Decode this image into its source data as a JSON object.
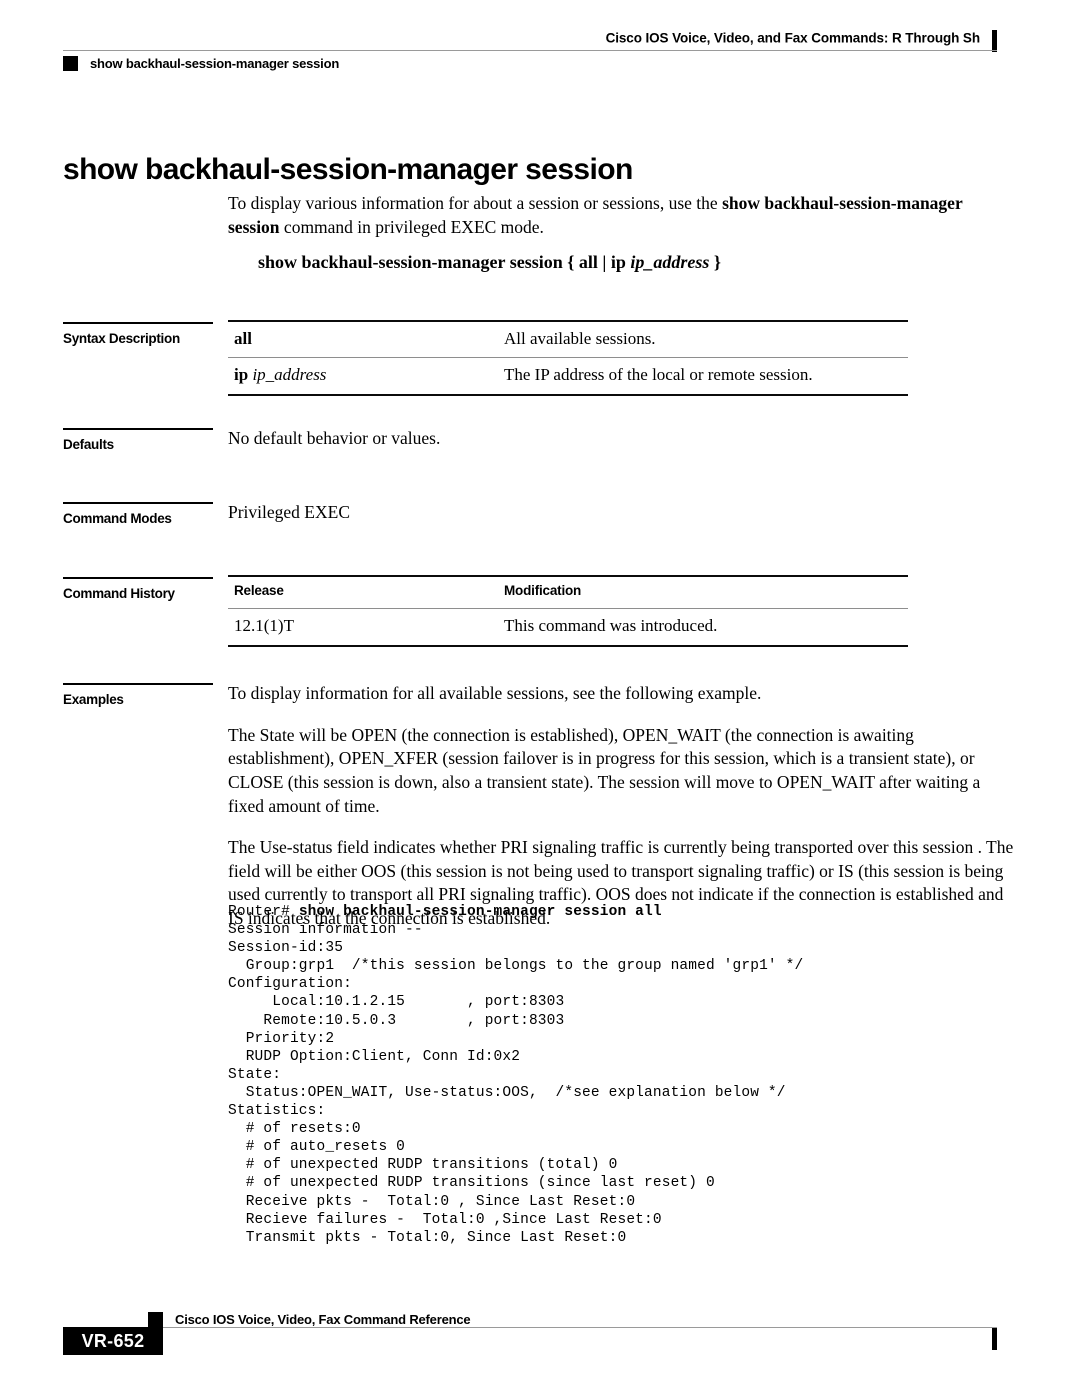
{
  "header": {
    "book_title": "Cisco IOS Voice, Video, and Fax Commands: R Through Sh",
    "running_head": "show backhaul-session-manager session"
  },
  "page": {
    "command_title": "show backhaul-session-manager session",
    "intro": {
      "text_before": "To display various information for about a session or sessions, use the ",
      "bold_command": "show backhaul-session-manager session",
      "text_after": " command in privileged EXEC mode."
    },
    "syntax": {
      "command": "show backhaul-session-manager session",
      "open_brace": "{",
      "option_all": "all",
      "pipe": "|",
      "option_ip": "ip",
      "argument": "ip_address",
      "close_brace": "}"
    }
  },
  "sections": {
    "syntax_description": {
      "label": "Syntax Description",
      "rows": [
        {
          "term": "all",
          "term_italic": "",
          "description": "All available sessions."
        },
        {
          "term": "ip",
          "term_italic": "ip_address",
          "description": "The IP address of the local or remote session."
        }
      ]
    },
    "defaults": {
      "label": "Defaults",
      "text": "No default behavior or values."
    },
    "command_modes": {
      "label": "Command Modes",
      "text": "Privileged EXEC"
    },
    "command_history": {
      "label": "Command History",
      "headers": {
        "release": "Release",
        "modification": "Modification"
      },
      "rows": [
        {
          "release": "12.1(1)T",
          "modification": "This command was introduced."
        }
      ]
    },
    "examples": {
      "label": "Examples",
      "paragraphs": [
        "To display information for all available sessions, see the following example.",
        "The State will be OPEN (the connection is established), OPEN_WAIT (the connection is awaiting establishment), OPEN_XFER (session failover is in progress for this session, which is a transient state), or CLOSE (this session is down, also a transient state). The session will move to OPEN_WAIT after waiting a fixed amount of time.",
        "The Use-status field indicates whether PRI signaling traffic is currently being transported over this session . The field will be either OOS (this session is not being used to transport signaling traffic) or IS (this session is being used currently to transport all PRI signaling traffic). OOS does not indicate if the connection is established and IS indicates that the connection is established."
      ],
      "console_output": {
        "prompt": "Router# ",
        "typed_command": "show backhaul-session-manager session all",
        "body": "\nSession information --\nSession-id:35\n  Group:grp1  /*this session belongs to the group named 'grp1' */\nConfiguration:\n     Local:10.1.2.15       , port:8303\n    Remote:10.5.0.3        , port:8303\n  Priority:2\n  RUDP Option:Client, Conn Id:0x2\nState:\n  Status:OPEN_WAIT, Use-status:OOS,  /*see explanation below */\nStatistics:\n  # of resets:0\n  # of auto_resets 0\n  # of unexpected RUDP transitions (total) 0\n  # of unexpected RUDP transitions (since last reset) 0\n  Receive pkts -  Total:0 , Since Last Reset:0\n  Recieve failures -  Total:0 ,Since Last Reset:0\n  Transmit pkts - Total:0, Since Last Reset:0"
      }
    }
  },
  "footer": {
    "page_number": "VR-652",
    "book_reference": "Cisco IOS Voice, Video, Fax Command Reference"
  }
}
